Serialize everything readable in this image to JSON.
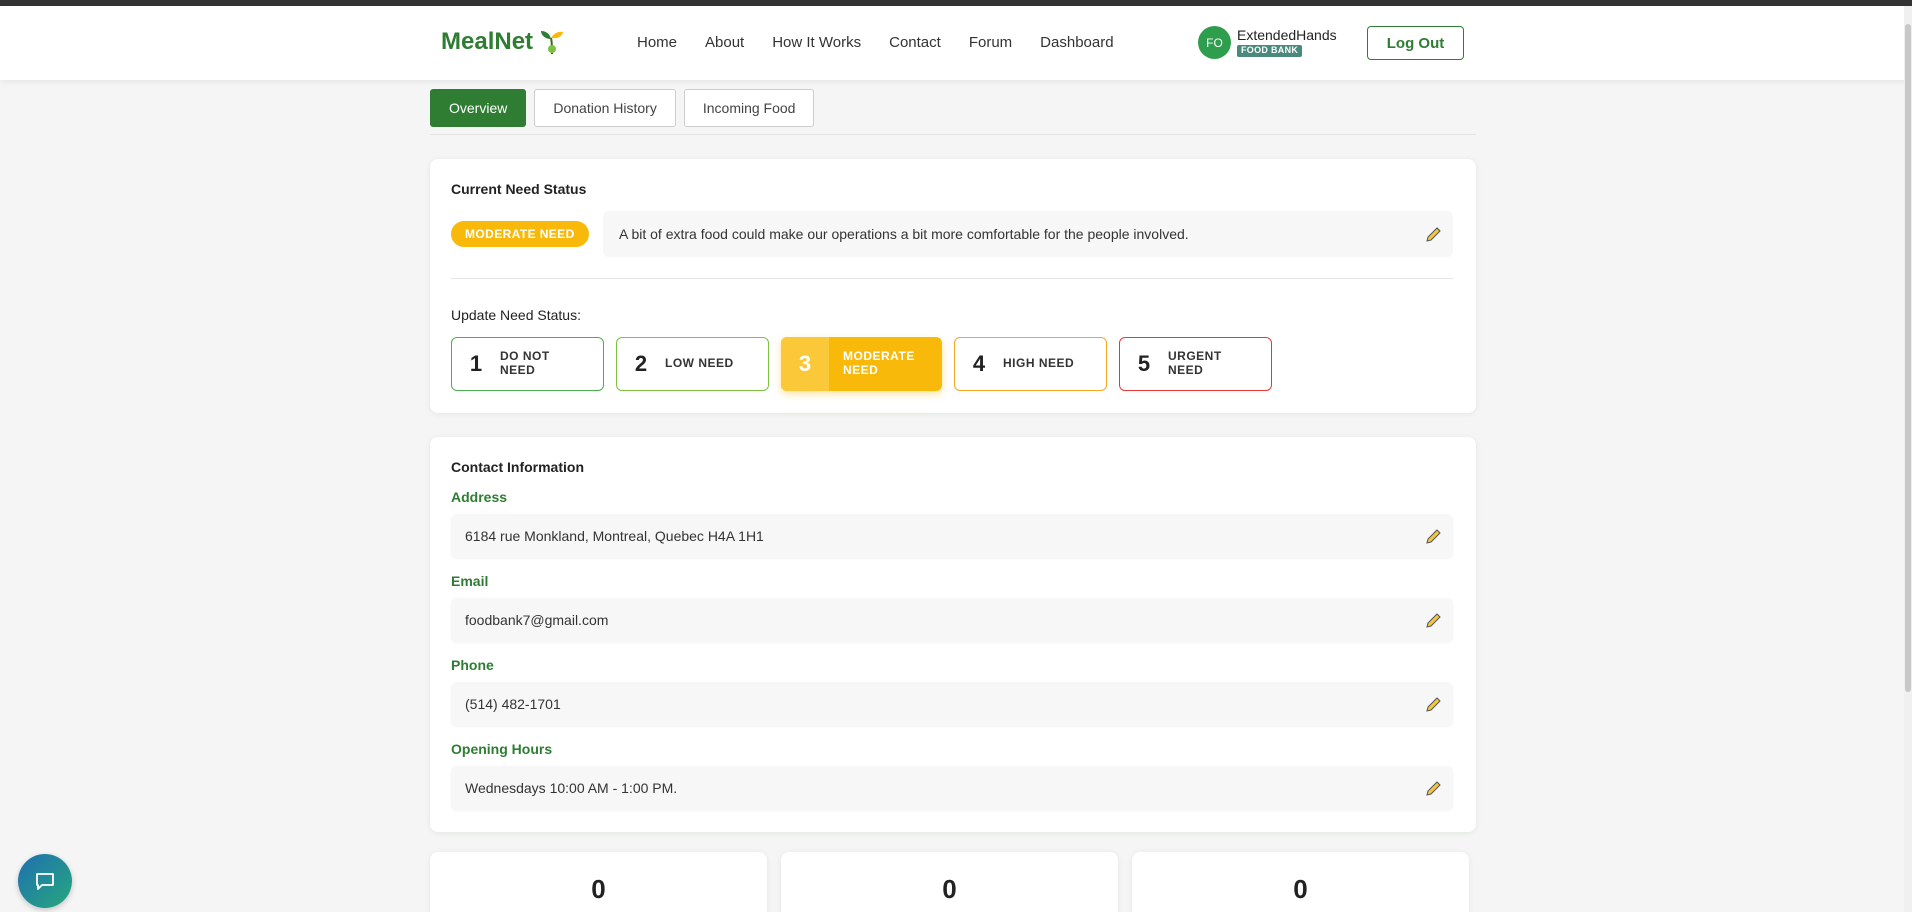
{
  "app": {
    "name": "MealNet"
  },
  "nav": {
    "items": [
      "Home",
      "About",
      "How It Works",
      "Contact",
      "Forum",
      "Dashboard"
    ]
  },
  "user": {
    "initials": "FO",
    "name": "ExtendedHands",
    "role": "FOOD BANK"
  },
  "header": {
    "logout_label": "Log Out"
  },
  "tabs": [
    {
      "label": "Overview",
      "active": true
    },
    {
      "label": "Donation History",
      "active": false
    },
    {
      "label": "Incoming Food",
      "active": false
    }
  ],
  "need": {
    "title": "Current Need Status",
    "badge": "MODERATE NEED",
    "message": "A bit of extra food could make our operations a bit more comfortable for the people involved.",
    "update_label": "Update Need Status:",
    "levels": [
      {
        "num": "1",
        "label": "DO NOT NEED",
        "color": "#4caf50"
      },
      {
        "num": "2",
        "label": "LOW NEED",
        "color": "#7cc142"
      },
      {
        "num": "3",
        "label": "MODERATE NEED",
        "color": "#f9b90a",
        "selected": true
      },
      {
        "num": "4",
        "label": "HIGH NEED",
        "color": "#f5a623"
      },
      {
        "num": "5",
        "label": "URGENT NEED",
        "color": "#e53935"
      }
    ]
  },
  "contact": {
    "title": "Contact Information",
    "address_label": "Address",
    "address": "6184 rue Monkland, Montreal, Quebec H4A 1H1",
    "email_label": "Email",
    "email": "foodbank7@gmail.com",
    "phone_label": "Phone",
    "phone": "(514) 482-1701",
    "hours_label": "Opening Hours",
    "hours": "Wednesdays 10:00 AM - 1:00 PM."
  },
  "stats": [
    "0",
    "0",
    "0"
  ],
  "colors": {
    "brand": "#2e7d32",
    "moderate": "#f9b90a"
  }
}
